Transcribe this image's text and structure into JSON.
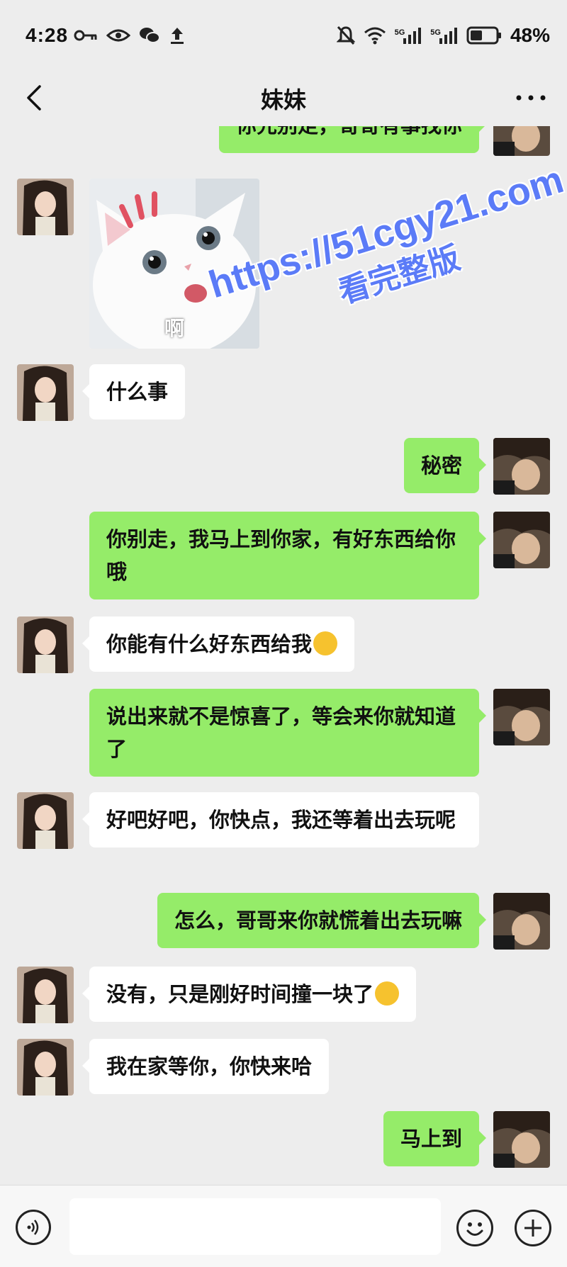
{
  "status_bar": {
    "time": "4:28",
    "network_tag_1": "5G",
    "network_tag_2": "5G",
    "battery": "48%",
    "battery_level": 0.48
  },
  "header": {
    "title": "妹妹"
  },
  "messages": [
    {
      "from": "self",
      "text": "你先别走，哥哥有事找你"
    },
    {
      "from": "other",
      "type": "sticker",
      "caption": "啊"
    },
    {
      "from": "other",
      "text": "什么事"
    },
    {
      "from": "self",
      "text": "秘密"
    },
    {
      "from": "self",
      "text": "你别走，我马上到你家，有好东西给你哦"
    },
    {
      "from": "other",
      "text": "你能有什么好东西给我",
      "emoji": "hand-over-mouth-emoji"
    },
    {
      "from": "self",
      "text": "说出来就不是惊喜了，等会来你就知道了"
    },
    {
      "from": "other",
      "text": "好吧好吧，你快点，我还等着出去玩呢"
    },
    {
      "from": "self",
      "text": "怎么，哥哥来你就慌着出去玩嘛"
    },
    {
      "from": "other",
      "text": "没有，只是刚好时间撞一块了",
      "emoji": "crying-laughing-emoji"
    },
    {
      "from": "other",
      "text": "我在家等你，你快来哈"
    },
    {
      "from": "self",
      "text": "马上到"
    }
  ],
  "watermark": {
    "line1": "https://51cgy21.com",
    "line2": "看完整版"
  },
  "input_bar": {
    "value": ""
  },
  "colors": {
    "self_bubble": "#95ec69",
    "other_bubble": "#ffffff",
    "background": "#ededed",
    "watermark": "#5b7bf7"
  }
}
